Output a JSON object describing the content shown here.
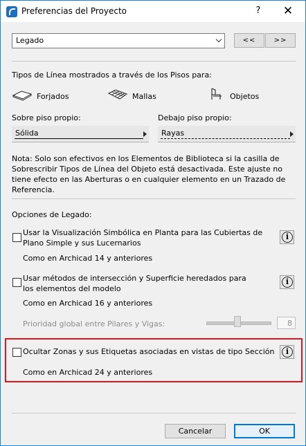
{
  "window": {
    "title": "Preferencias del Proyecto",
    "help": "?",
    "close": "✕"
  },
  "preset": {
    "value": "Legado",
    "prev": "<<",
    "next": ">>"
  },
  "line_types": {
    "heading": "Tipos de Línea mostrados a través de los Pisos para:",
    "items": [
      {
        "icon": "slab-icon",
        "label": "Forjados"
      },
      {
        "icon": "mesh-icon",
        "label": "Mallas"
      },
      {
        "icon": "chair-icon",
        "label": "Objetos"
      }
    ],
    "own_story": {
      "label": "Sobre piso propio:",
      "value": "Sólida"
    },
    "below_story": {
      "label": "Debajo piso propio:",
      "value": "Rayas"
    },
    "note": "Nota: Solo son efectivos en los Elementos de Biblioteca si la casilla de Sobrescribir Tipos de Línea del Objeto está desactivada. Este ajuste no tiene efecto en las Aberturas o en cualquier elemento en un Trazado de Referencia."
  },
  "legacy": {
    "heading": "Opciones de Legado:",
    "opt1": {
      "label": "Usar la Visualización Simbólica en Planta para las Cubiertas de Plano Simple y sus Lucernarios",
      "desc": "Como en Archicad 14 y anteriores",
      "checked": false
    },
    "opt2": {
      "label": "Usar métodos de intersección y Superficie heredados para los elementos del modelo",
      "desc": "Como en Archicad 16 y anteriores",
      "checked": false
    },
    "priority": {
      "label": "Prioridad global entre Pilares y Vigas:",
      "value": "8"
    },
    "opt3": {
      "label": "Ocultar Zonas y sus Etiquetas asociadas en vistas de tipo Sección",
      "desc": "Como en Archicad 24 y anteriores",
      "checked": false
    }
  },
  "footer": {
    "cancel": "Cancelar",
    "ok": "OK"
  },
  "colors": {
    "accent": "#1883d7",
    "highlight": "#e0141e"
  }
}
